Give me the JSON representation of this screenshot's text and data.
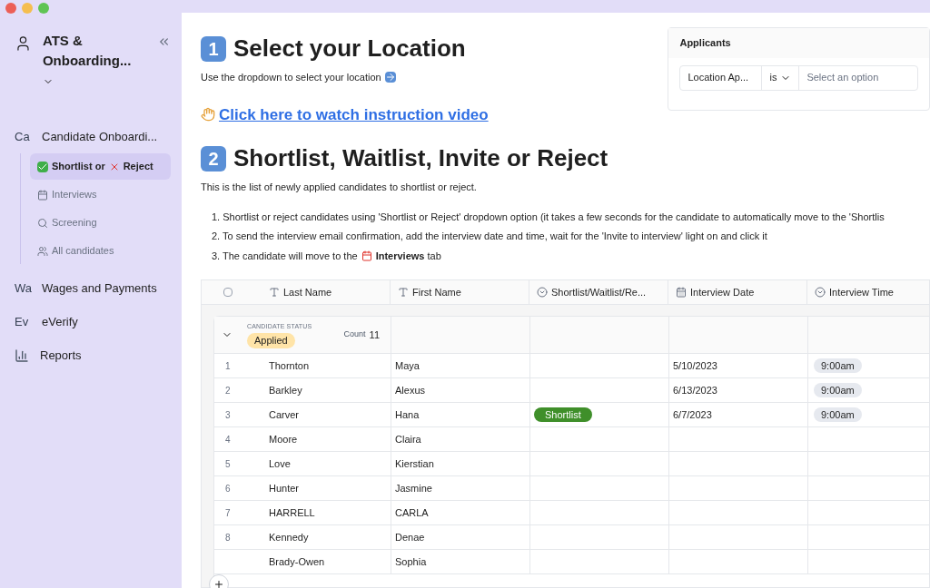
{
  "sidebar": {
    "workspace": "ATS & Onboarding...",
    "sections": [
      {
        "abbr": "Ca",
        "label": "Candidate Onboardi...",
        "children": [
          {
            "label": "Shortlist or",
            "label2": "Reject",
            "selected": true
          },
          {
            "label": "Interviews",
            "selected": false
          },
          {
            "label": "Screening",
            "selected": false
          },
          {
            "label": "All candidates",
            "selected": false
          }
        ]
      },
      {
        "abbr": "Wa",
        "label": "Wages and Payments"
      },
      {
        "abbr": "Ev",
        "label": "eVerify"
      },
      {
        "label": "Reports"
      }
    ]
  },
  "section1": {
    "number": "1",
    "title": "Select your Location",
    "text": "Use the dropdown to select your location",
    "link": "Click here to watch instruction video"
  },
  "filter": {
    "title": "Applicants",
    "field": "Location Ap...",
    "operator": "is",
    "placeholder": "Select an option"
  },
  "section2": {
    "number": "2",
    "title": "Shortlist, Waitlist, Invite or Reject",
    "text": "This is the list of newly applied candidates to shortlist or reject.",
    "steps": [
      "1. Shortlist or reject candidates using 'Shortlist or Reject' dropdown option (it takes a few seconds for the candidate to automatically move to the 'Shortlis",
      "2. To send the interview email confirmation, add the interview date and time, wait for the 'Invite to interview' light on and click it"
    ],
    "step3_before": "3. The candidate will move to the",
    "step3_after": "**Interviews** tab"
  },
  "table": {
    "select_all": {
      "checked": false
    },
    "columns": [
      {
        "label": "Last Name",
        "kind": "text"
      },
      {
        "label": "First Name",
        "kind": "text"
      },
      {
        "label": "Shortlist/Waitlist/Re...",
        "kind": "select"
      },
      {
        "label": "Interview Date",
        "kind": "date"
      },
      {
        "label": "Interview Time",
        "kind": "select"
      }
    ],
    "group": {
      "heading": "CANDIDATE STATUS",
      "status": "Applied",
      "count_label": "Count",
      "count": "11",
      "expanded": true
    },
    "rows": [
      {
        "n": "1",
        "last": "Thornton",
        "first": "Maya",
        "date": "5/10/2023",
        "time": "9:00am"
      },
      {
        "n": "2",
        "last": "Barkley",
        "first": "Alexus",
        "date": "6/13/2023",
        "time": "9:00am"
      },
      {
        "n": "3",
        "last": "Carver",
        "first": "Hana",
        "decision": "Shortlist",
        "date": "6/7/2023",
        "time": "9:00am"
      },
      {
        "n": "4",
        "last": "Moore",
        "first": "Claira"
      },
      {
        "n": "5",
        "last": "Love",
        "first": "Kierstian"
      },
      {
        "n": "6",
        "last": "Hunter",
        "first": "Jasmine"
      },
      {
        "n": "7",
        "last": "HARRELL",
        "first": "CARLA"
      },
      {
        "n": "8",
        "last": "Kennedy",
        "first": "Denae"
      },
      {
        "last": "Brady-Owen",
        "first": "Sophia"
      }
    ]
  }
}
